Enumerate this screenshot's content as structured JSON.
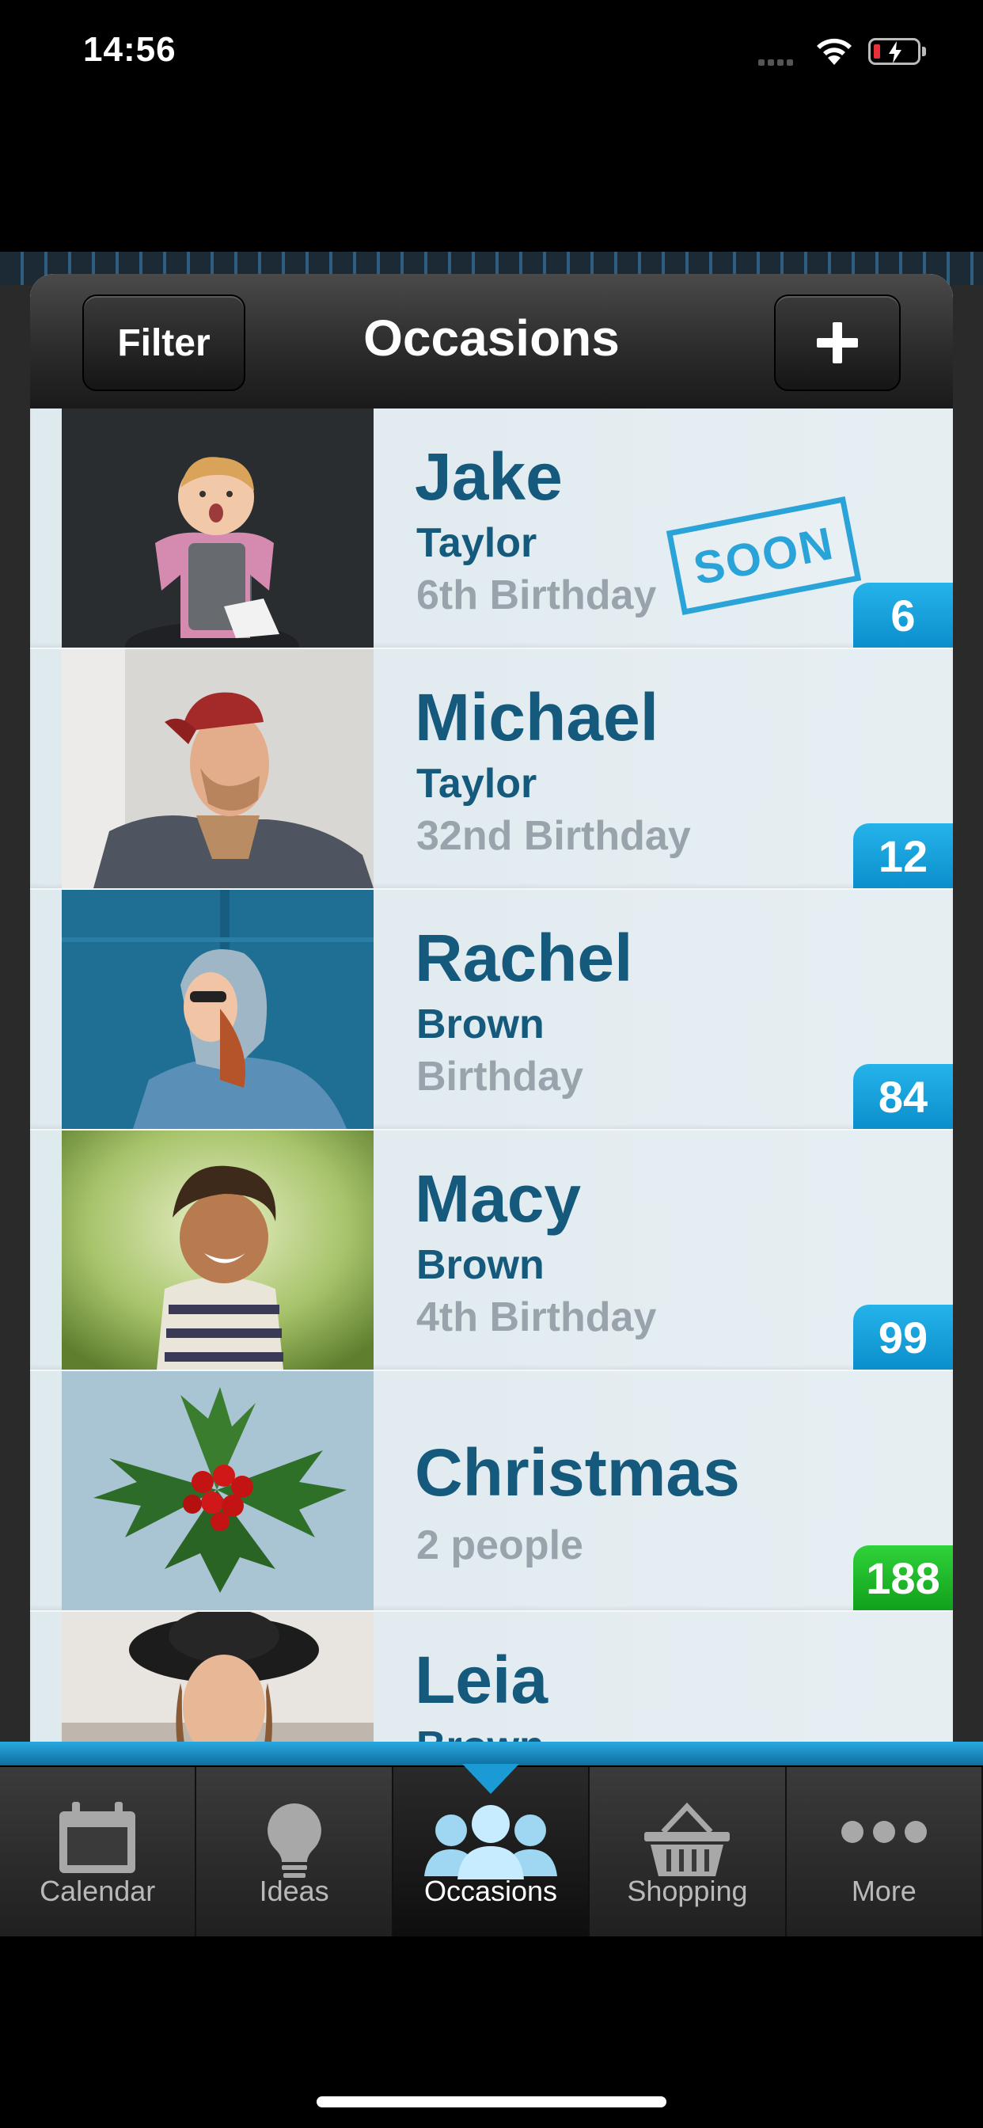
{
  "status_bar": {
    "time": "14:56"
  },
  "navbar": {
    "title": "Occasions",
    "filter_label": "Filter",
    "add_icon": "plus-icon"
  },
  "occasions": [
    {
      "name": "Jake",
      "last_name": "Taylor",
      "occasion": "6th Birthday",
      "days": "6",
      "stamp": "SOON",
      "badge_color": "#16a0dc"
    },
    {
      "name": "Michael",
      "last_name": "Taylor",
      "occasion": "32nd Birthday",
      "days": "12",
      "badge_color": "#16a0dc"
    },
    {
      "name": "Rachel",
      "last_name": "Brown",
      "occasion": "Birthday",
      "days": "84",
      "badge_color": "#16a0dc"
    },
    {
      "name": "Macy",
      "last_name": "Brown",
      "occasion": "4th Birthday",
      "days": "99",
      "badge_color": "#16a0dc"
    },
    {
      "name": "Christmas",
      "occasion": "2 people",
      "days": "188",
      "badge_color": "#1cb526"
    },
    {
      "name": "Leia",
      "last_name": "Brown"
    }
  ],
  "tabbar": {
    "tabs": [
      {
        "label": "Calendar",
        "icon": "calendar-icon"
      },
      {
        "label": "Ideas",
        "icon": "lightbulb-icon"
      },
      {
        "label": "Occasions",
        "icon": "people-icon",
        "active": true
      },
      {
        "label": "Shopping",
        "icon": "basket-icon"
      },
      {
        "label": "More",
        "icon": "more-icon"
      }
    ]
  },
  "colors": {
    "accent": "#16a0dc",
    "name_text": "#155a7c",
    "secondary_text": "#98a3ab"
  }
}
